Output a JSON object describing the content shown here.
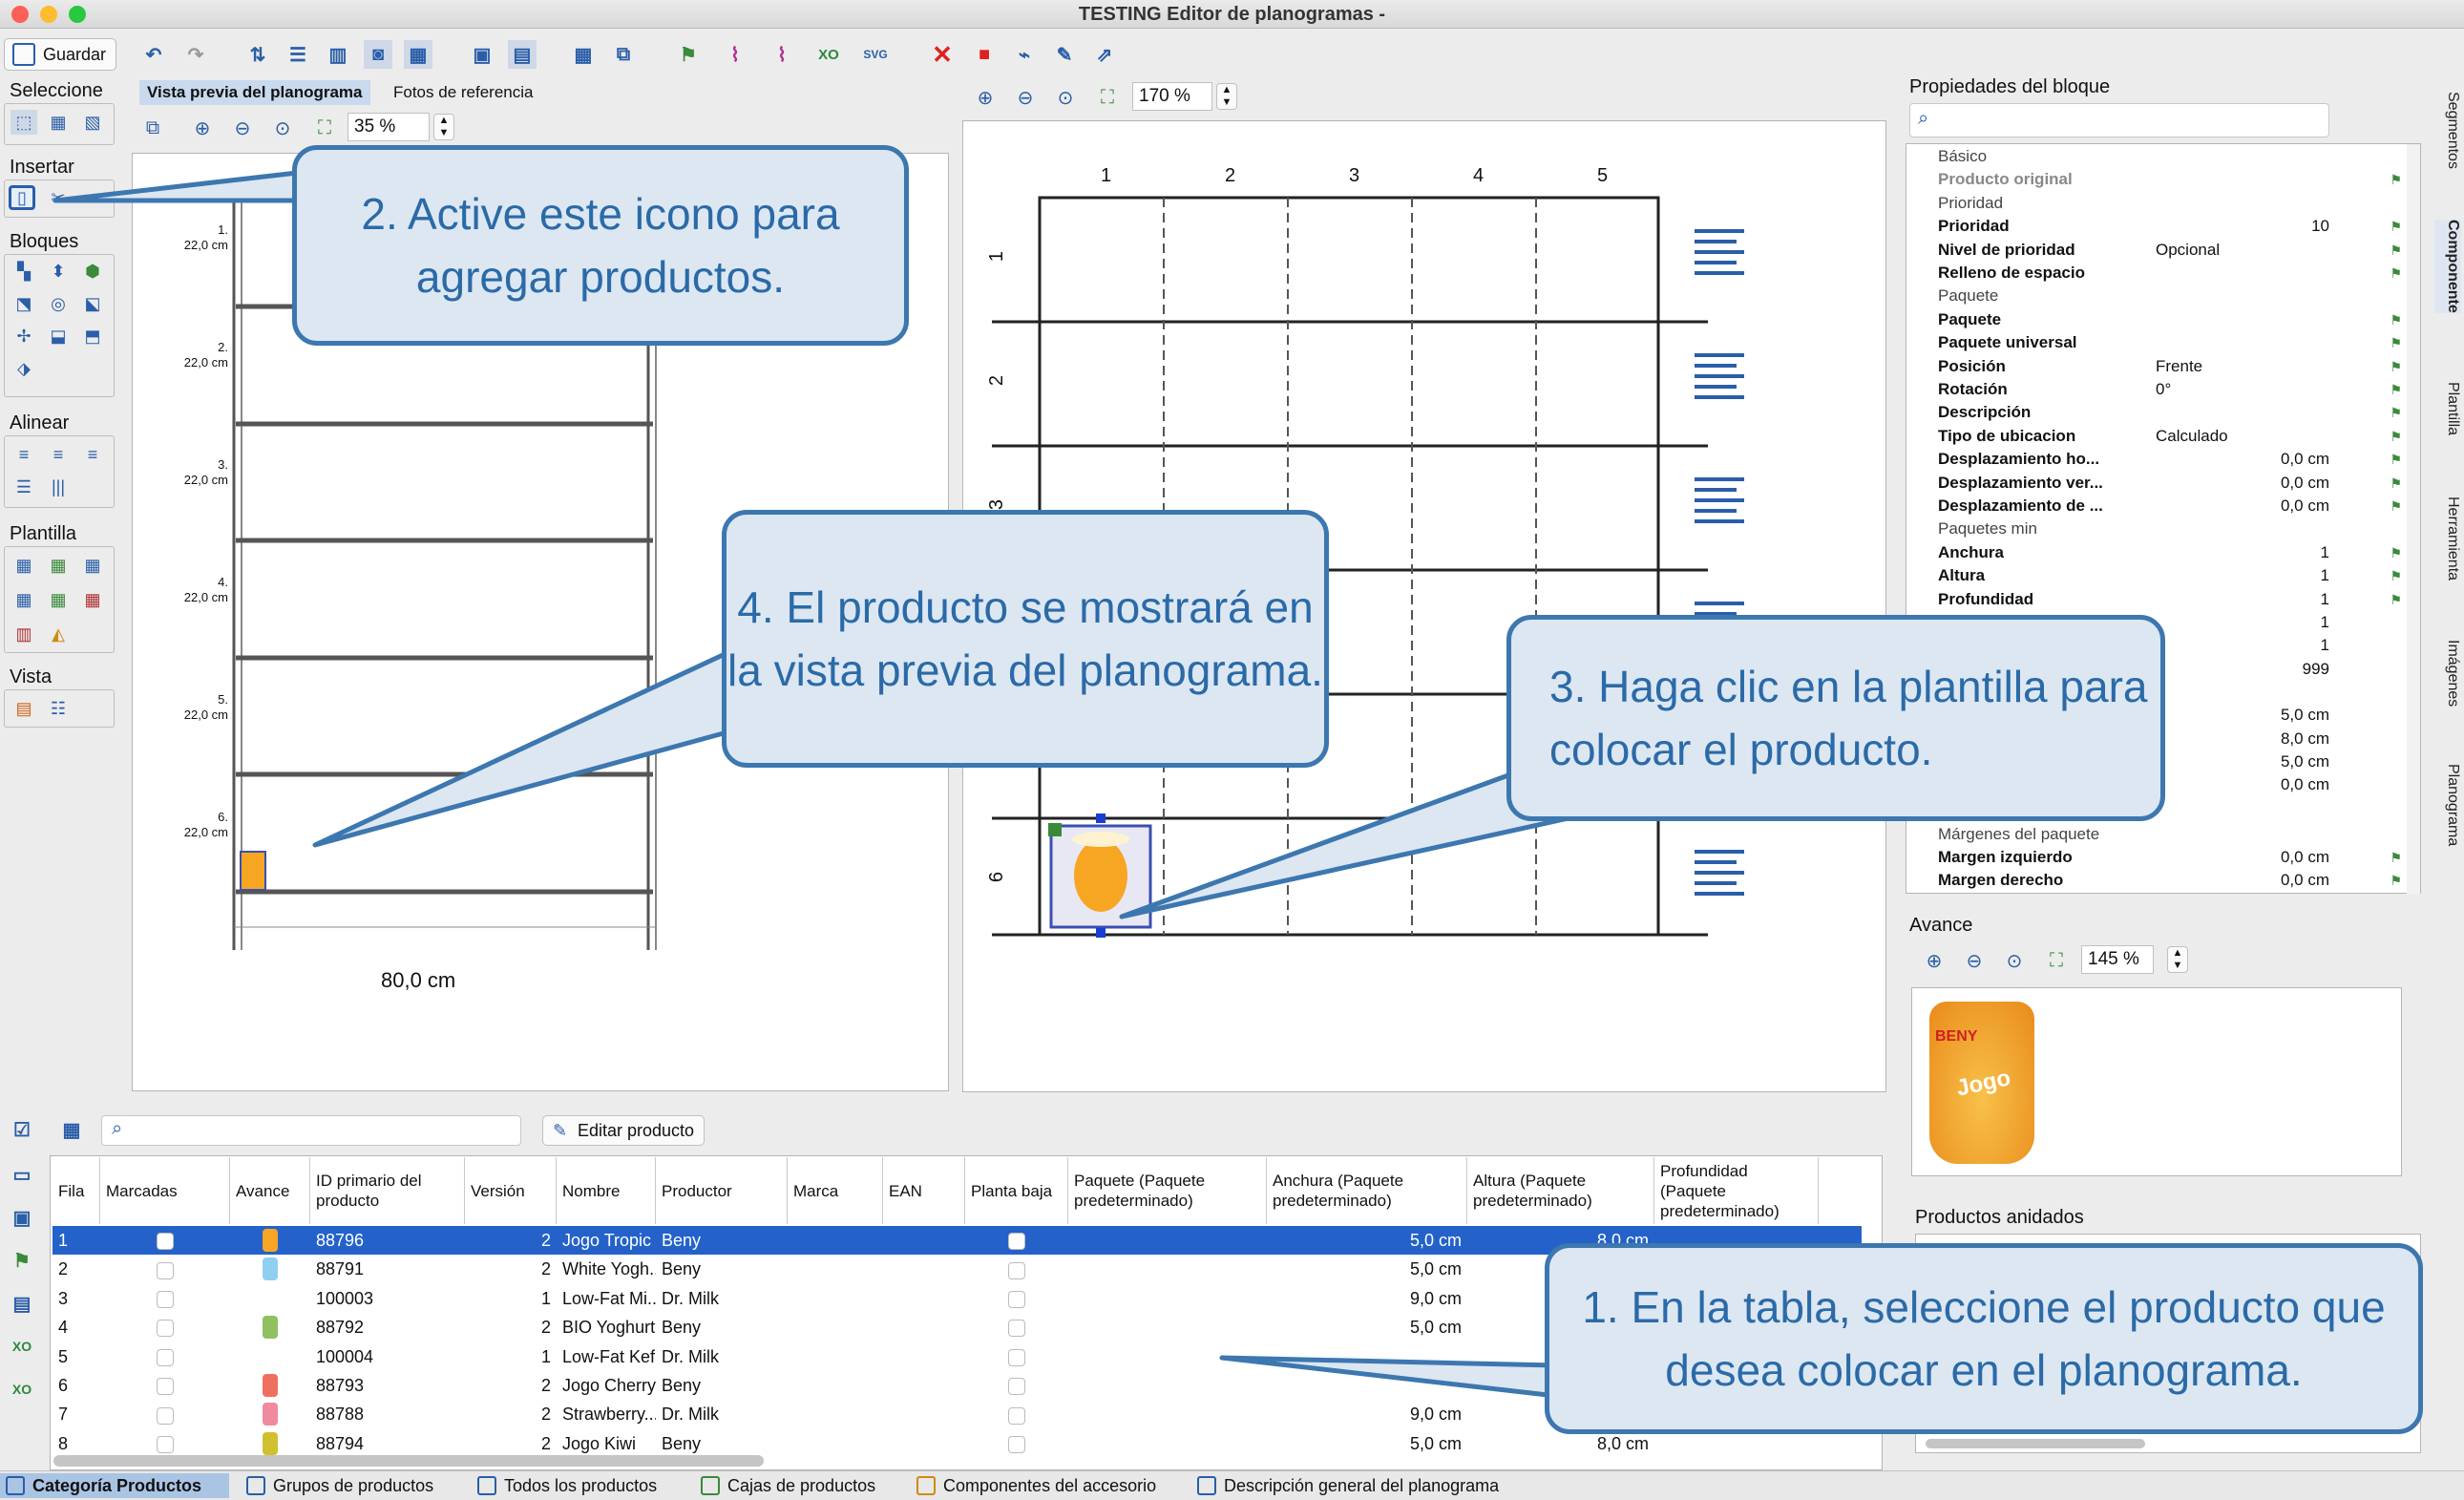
{
  "window": {
    "title": "TESTING Editor de planogramas -"
  },
  "toolbar": {
    "save_label": "Guardar"
  },
  "palette": {
    "seleccione": "Seleccione",
    "insertar": "Insertar",
    "bloques": "Bloques",
    "alinear": "Alinear",
    "plantilla": "Plantilla",
    "vista": "Vista"
  },
  "preview": {
    "tab_active": "Vista previa del planograma",
    "tab_other": "Fotos de referencia",
    "zoom": "35 %",
    "shelf_labels": [
      "1.\n22,0 cm",
      "2.\n22,0 cm",
      "3.\n22,0 cm",
      "4.\n22,0 cm",
      "5.\n22,0 cm",
      "6.\n22,0 cm"
    ],
    "width_label": "80,0 cm"
  },
  "template": {
    "zoom": "170 %",
    "columns": [
      "1",
      "2",
      "3",
      "4",
      "5"
    ],
    "rows": [
      "1",
      "2",
      "3",
      "6"
    ]
  },
  "props": {
    "title": "Propiedades del bloque",
    "rows": [
      {
        "type": "sec",
        "k": "Básico"
      },
      {
        "type": "kv",
        "k": "Producto original",
        "v": "",
        "dim": true
      },
      {
        "type": "sec",
        "k": "Prioridad"
      },
      {
        "type": "kv",
        "k": "Prioridad",
        "vr": "10"
      },
      {
        "type": "kv",
        "k": "Nivel de prioridad",
        "v": "Opcional"
      },
      {
        "type": "kv",
        "k": "Relleno de espacio",
        "v": ""
      },
      {
        "type": "sec",
        "k": "Paquete"
      },
      {
        "type": "kv",
        "k": "Paquete",
        "v": ""
      },
      {
        "type": "kv",
        "k": "Paquete universal",
        "v": ""
      },
      {
        "type": "kv",
        "k": "Posición",
        "v": "Frente"
      },
      {
        "type": "kv",
        "k": "Rotación",
        "v": "0°"
      },
      {
        "type": "kv",
        "k": "Descripción",
        "v": ""
      },
      {
        "type": "kv",
        "k": "Tipo de ubicacion",
        "v": "Calculado"
      },
      {
        "type": "kv",
        "k": "Desplazamiento ho...",
        "vr": "0,0 cm"
      },
      {
        "type": "kv",
        "k": "Desplazamiento ver...",
        "vr": "0,0 cm"
      },
      {
        "type": "kv",
        "k": "Desplazamiento de ...",
        "vr": "0,0 cm"
      },
      {
        "type": "sec",
        "k": "Paquetes min"
      },
      {
        "type": "kv",
        "k": "Anchura",
        "vr": "1"
      },
      {
        "type": "kv",
        "k": "Altura",
        "vr": "1"
      },
      {
        "type": "kv",
        "k": "Profundidad",
        "vr": "1"
      }
    ],
    "hidden_values": [
      "1",
      "1",
      "999",
      "5,0 cm",
      "8,0 cm",
      "5,0 cm",
      "0,0 cm"
    ],
    "margins_section": "Márgenes del paquete",
    "margin_left": "Margen izquierdo",
    "margin_left_val": "0,0 cm",
    "margin_right": "Margen derecho",
    "margin_right_val": "0,0 cm"
  },
  "avance": {
    "title": "Avance",
    "zoom": "145 %",
    "product_brand": "BENY",
    "product_name": "Jogo"
  },
  "nested": {
    "title": "Productos anidados"
  },
  "table": {
    "edit_button": "Editar producto",
    "headers": [
      "Fila",
      "Marcadas",
      "Avance",
      "ID primario del producto",
      "Versión",
      "Nombre",
      "Productor",
      "Marca",
      "EAN",
      "Planta baja",
      "Paquete (Paquete predeterminado)",
      "Anchura (Paquete predeterminado)",
      "Altura (Paquete predeterminado)",
      "Profundidad (Paquete predeterminado)"
    ],
    "rows": [
      {
        "fila": "1",
        "id": "88796",
        "version": "2",
        "nombre": "Jogo Tropic",
        "productor": "Beny",
        "anchura": "5,0 cm",
        "altura": "8,0 cm"
      },
      {
        "fila": "2",
        "id": "88791",
        "version": "2",
        "nombre": "White Yogh...",
        "productor": "Beny",
        "anchura": "5,0 cm",
        "altura": ""
      },
      {
        "fila": "3",
        "id": "100003",
        "version": "1",
        "nombre": "Low-Fat Mi...",
        "productor": "Dr. Milk",
        "anchura": "9,0 cm",
        "altura": ""
      },
      {
        "fila": "4",
        "id": "88792",
        "version": "2",
        "nombre": "BIO Yoghurt",
        "productor": "Beny",
        "anchura": "5,0 cm",
        "altura": ""
      },
      {
        "fila": "5",
        "id": "100004",
        "version": "1",
        "nombre": "Low-Fat Kefir",
        "productor": "Dr. Milk",
        "anchura": "",
        "altura": ""
      },
      {
        "fila": "6",
        "id": "88793",
        "version": "2",
        "nombre": "Jogo Cherry",
        "productor": "Beny",
        "anchura": "",
        "altura": ""
      },
      {
        "fila": "7",
        "id": "88788",
        "version": "2",
        "nombre": "Strawberry...",
        "productor": "Dr. Milk",
        "anchura": "9,0 cm",
        "altura": ""
      },
      {
        "fila": "8",
        "id": "88794",
        "version": "2",
        "nombre": "Jogo Kiwi",
        "productor": "Beny",
        "anchura": "5,0 cm",
        "altura": "8,0 cm"
      }
    ]
  },
  "bottom_tabs": [
    "Categoría Productos",
    "Grupos de productos",
    "Todos los productos",
    "Cajas de productos",
    "Componentes del accesorio",
    "Descripción general del planograma"
  ],
  "side_tabs": [
    "Segmentos",
    "Componente",
    "Plantilla",
    "Herramienta",
    "Imágenes",
    "Planograma"
  ],
  "callouts": {
    "c1": "1. En la tabla, seleccione el producto que desea colocar en el planograma.",
    "c2": "2. Active este icono para agregar productos.",
    "c3": "3. Haga clic en la plantilla para colocar el producto.",
    "c4": "4. El producto se mostrará en la vista previa del planograma."
  },
  "colors": {
    "accent": "#2462c9",
    "callout_bg": "#dce7f2",
    "callout_border": "#3d77b0",
    "callout_text": "#2b6aa8"
  }
}
